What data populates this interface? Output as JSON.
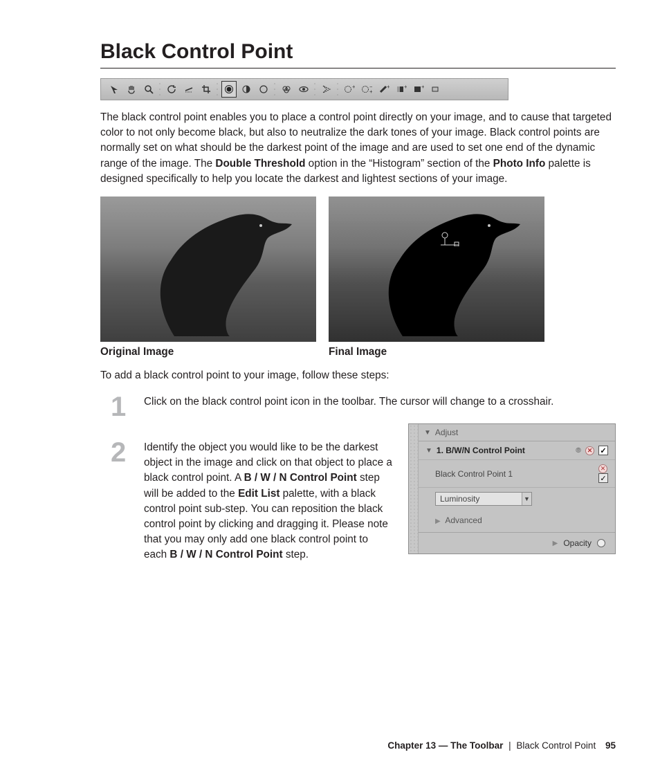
{
  "title": "Black Control Point",
  "intro_parts": {
    "p1": "The black control point enables you to place a control point directly on your image, and to cause that targeted color to not only become black, but also to neutralize the dark tones of your image. Black control points are normally set on what should be the darkest point of the image and are used to set one end of the dynamic range of the image. The ",
    "b1": "Double Threshold",
    "p2": " option in the “Histogram” section of the ",
    "b2": "Photo Info",
    "p3": " palette is designed specifically to help you locate the darkest and lightest sections of your image."
  },
  "captions": {
    "original": "Original Image",
    "final": "Final Image"
  },
  "steps_intro": "To add a black control point to your image, follow these steps:",
  "steps": {
    "1": {
      "num": "1",
      "text": "Click on the black control point icon in the toolbar. The cursor will change to a crosshair."
    },
    "2": {
      "num": "2",
      "a": "Identify the object you would like to be the darkest object in the image and click on that object to place a black control point. A ",
      "b1": "B / W / N Control Point",
      "c": " step will be added to the ",
      "b2": "Edit List",
      "d": " palette, with a black control point sub-step. You can reposition the black control point by clicking and dragging it. Please note that you may only add one black control point to each ",
      "b3": "B / W / N Control Point",
      "e": " step."
    }
  },
  "palette": {
    "adjust": "Adjust",
    "step_title": "1. B/W/N Control Point",
    "substep": "Black Control Point 1",
    "dropdown": "Luminosity",
    "advanced": "Advanced",
    "opacity": "Opacity"
  },
  "footer": {
    "chapter": "Chapter 13 — The Toolbar",
    "section": "Black Control Point",
    "page": "95"
  }
}
